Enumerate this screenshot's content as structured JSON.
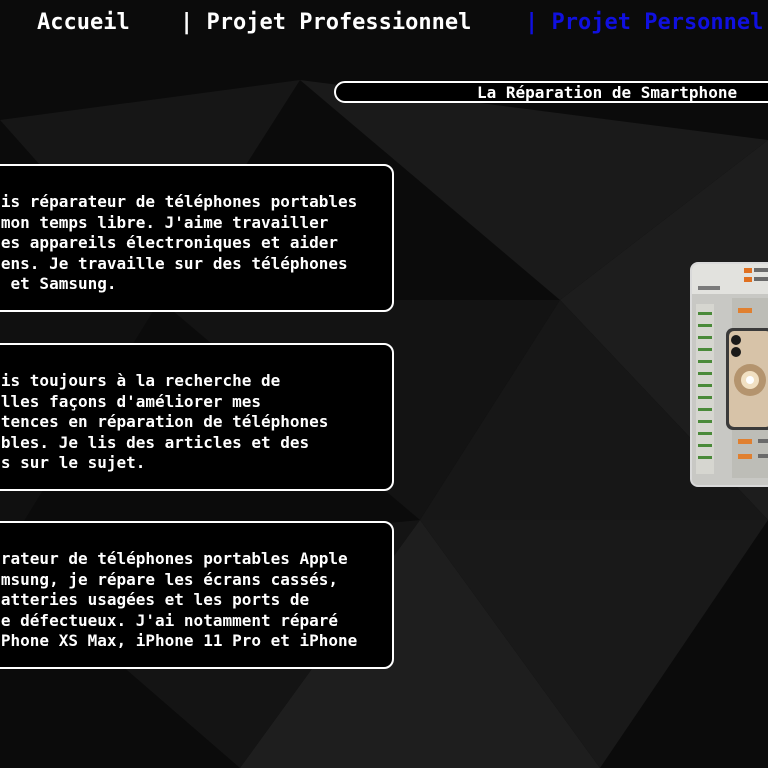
{
  "nav": {
    "home": "Accueil",
    "pro": "| Projet Professionnel",
    "perso": "| Projet Personnel"
  },
  "section": {
    "title": "La Réparation de Smartphone"
  },
  "cards": [
    {
      "text": "   is réparateur de téléphones portables\n   mon temps libre. J'aime travailler\n   es appareils électroniques et aider\n   ens. Je travaille sur des téléphones\n    et Samsung."
    },
    {
      "text": "   is toujours à la recherche de\n   lles façons d'améliorer mes\n   tences en réparation de téléphones\n   bles. Je lis des articles et des\n   s sur le sujet."
    },
    {
      "text": "   rateur de téléphones portables Apple\n   msung, je répare les écrans cassés,\n   atteries usagées et les ports de\n   e défectueux. J'ai notamment réparé\n   Phone XS Max, iPhone 11 Pro et iPhone"
    }
  ],
  "colors": {
    "active_nav": "#1010e0",
    "background": "#0b0b0b",
    "border": "#ffffff"
  }
}
